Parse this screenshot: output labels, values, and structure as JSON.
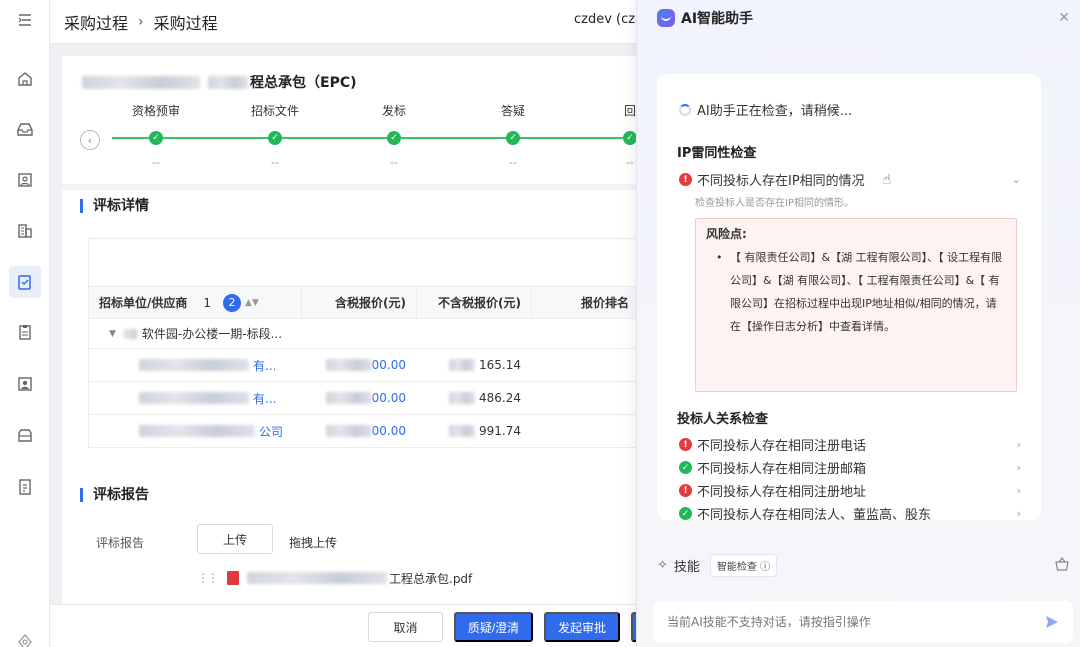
{
  "header": {
    "breadcrumb": [
      "采购过程",
      "采购过程"
    ],
    "user": "czdev (czd"
  },
  "project": {
    "title_suffix": "程总承包（EPC)"
  },
  "steps": [
    {
      "label": "资格预审",
      "value": "--"
    },
    {
      "label": "招标文件",
      "value": "--"
    },
    {
      "label": "发标",
      "value": "--"
    },
    {
      "label": "答疑",
      "value": "--"
    },
    {
      "label": "回",
      "value": "--"
    }
  ],
  "evaluation": {
    "section_title": "评标详情",
    "columns": [
      "招标单位/供应商",
      "含税报价(元)",
      "不含税报价(元)",
      "报价排名"
    ],
    "sort_num": "1",
    "sort_badge": "2",
    "group_label": "软件园-办公楼一期-标段...",
    "rows": [
      {
        "supplier": "有...",
        "tax_price": "00.00",
        "notax_price": "165.14"
      },
      {
        "supplier": "有...",
        "tax_price": "00.00",
        "notax_price": "486.24"
      },
      {
        "supplier": "公司",
        "tax_price": "00.00",
        "notax_price": "991.74"
      }
    ]
  },
  "report": {
    "section_title": "评标报告",
    "label": "评标报告",
    "upload_label": "上传",
    "drag_label": "拖拽上传",
    "file_name_suffix": "工程总承包.pdf"
  },
  "footer": {
    "cancel": "取消",
    "clarify": "质疑/澄清",
    "approve": "发起审批"
  },
  "ai": {
    "title": "AI智能助手",
    "status": "AI助手正在检查，请稍候...",
    "ip_section": "IP雷同性检查",
    "ip_check": "不同投标人存在IP相同的情况",
    "ip_desc": "检查投标人是否存在IP相同的情形。",
    "risk_title": "风险点:",
    "risk_text": "【 有限责任公司】&【湖 工程有限公司】、【 设工程有限公司】&【湖 有限公司】、【 工程有限责任公司】&【 有限公司】在招标过程中出现IP地址相似/相同的情况，请在【操作日志分析】中查看详情。",
    "relation_section": "投标人关系检查",
    "relation_checks": [
      {
        "label": "不同投标人存在相同注册电话",
        "status": "error"
      },
      {
        "label": "不同投标人存在相同注册邮箱",
        "status": "ok"
      },
      {
        "label": "不同投标人存在相同注册地址",
        "status": "error"
      },
      {
        "label": "不同投标人存在相同法人、董监高、股东",
        "status": "ok"
      }
    ],
    "skills_label": "技能",
    "skill_pill": "智能检查",
    "input_placeholder": "当前AI技能不支持对话，请按指引操作"
  },
  "colors": {
    "primary": "#2f6bec",
    "success": "#22b85a",
    "error": "#e23c3c"
  }
}
